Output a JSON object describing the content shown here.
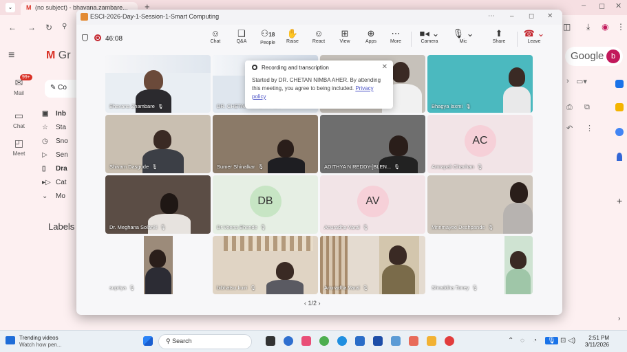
{
  "browser": {
    "tab_title": "(no subject) - bhavana.zambare...",
    "tab_close": "×",
    "new_tab": "+",
    "minimize": "–",
    "restore": "◻",
    "close": "✕"
  },
  "gmail": {
    "logo": "Gr",
    "rail": [
      {
        "label": "Mail",
        "badge": "99+"
      },
      {
        "label": "Chat"
      },
      {
        "label": "Meet"
      }
    ],
    "compose": "Co",
    "nav": [
      "Inb",
      "Sta",
      "Sno",
      "Sen",
      "Dra",
      "Cat",
      "Mo"
    ],
    "labels_heading": "Labels",
    "google": "Google",
    "avatar": "b"
  },
  "meeting": {
    "window_title": "ESCI-2026-Day-1-Session-1-Smart Computing",
    "timer": "46:08",
    "toolbar": [
      {
        "label": "Chat",
        "icon": "chat-icon"
      },
      {
        "label": "Q&A",
        "icon": "qa-icon"
      },
      {
        "label": "People",
        "icon": "people-icon",
        "count": "18"
      },
      {
        "label": "Raise",
        "icon": "raise-hand-icon"
      },
      {
        "label": "React",
        "icon": "react-icon"
      },
      {
        "label": "View",
        "icon": "view-icon"
      },
      {
        "label": "Apps",
        "icon": "apps-icon"
      },
      {
        "label": "More",
        "icon": "more-icon"
      },
      {
        "label": "Camera",
        "icon": "camera-icon"
      },
      {
        "label": "Mic",
        "icon": "mic-icon"
      },
      {
        "label": "Share",
        "icon": "share-icon"
      },
      {
        "label": "Leave",
        "icon": "leave-icon"
      }
    ],
    "popup": {
      "title": "Recording and transcription",
      "body": "Started by DR. CHETAN NIMBA AHER. By attending this meeting, you agree to being included.",
      "link": "Privacy policy"
    },
    "participants": [
      {
        "name": "Bhavana Zhambare",
        "kind": "video"
      },
      {
        "name": "DR. CHETAN NIMBA AHER",
        "kind": "video"
      },
      {
        "name": "",
        "kind": "video"
      },
      {
        "name": "Bhagya laxmi",
        "kind": "video"
      },
      {
        "name": "Shivam Dasgude",
        "kind": "video"
      },
      {
        "name": "Sumer Shinalkar",
        "kind": "video"
      },
      {
        "name": "ADITHYA N REDDY-[BLEN...",
        "kind": "video"
      },
      {
        "name": "Amrapali Chavhan",
        "kind": "avatar",
        "initials": "AC"
      },
      {
        "name": "Dr. Meghana Solanki",
        "kind": "video"
      },
      {
        "name": "Dr.Veena Bhende",
        "kind": "avatar",
        "initials": "DB"
      },
      {
        "name": "Anuradha Varal",
        "kind": "avatar",
        "initials": "AV"
      },
      {
        "name": "Mrinmayee Deshpande",
        "kind": "video"
      },
      {
        "name": "supriya",
        "kind": "video"
      },
      {
        "name": "bibhatsu kuiri",
        "kind": "video"
      },
      {
        "name": "Anuradha Varal",
        "kind": "video"
      },
      {
        "name": "Shraddha Toney",
        "kind": "video"
      }
    ],
    "pager": "1/2"
  },
  "taskbar": {
    "trending_title": "Trending videos",
    "trending_sub": "Watch how pen...",
    "search": "Search",
    "time": "2:51 PM",
    "date": "3/11/2026"
  }
}
